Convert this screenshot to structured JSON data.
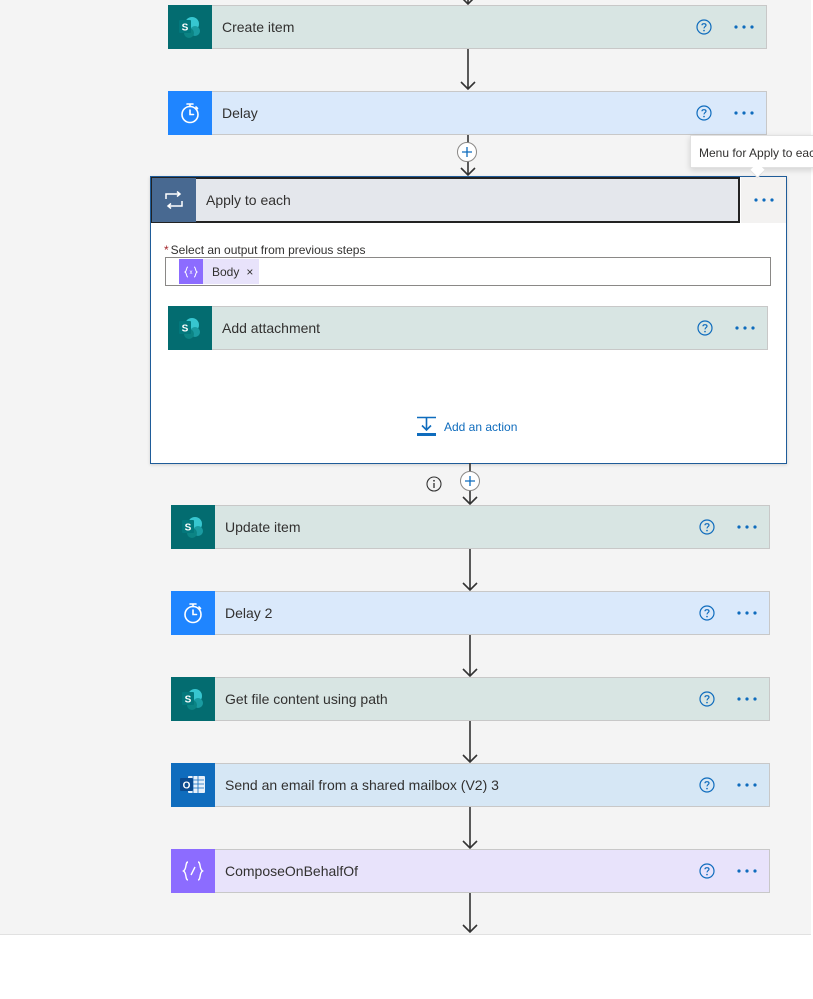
{
  "flow": {
    "create_item": {
      "title": "Create item",
      "icon": "sharepoint-icon"
    },
    "delay": {
      "title": "Delay",
      "icon": "timer-icon"
    },
    "apply_to_each": {
      "title": "Apply to each",
      "icon": "loop-icon",
      "select_label": "Select an output from previous steps",
      "required_marker": "*",
      "token": {
        "label": "Body",
        "remove": "×",
        "icon": "expression-icon"
      },
      "add_action_label": "Add an action"
    },
    "add_attachment": {
      "title": "Add attachment",
      "icon": "sharepoint-icon"
    },
    "update_item": {
      "title": "Update item",
      "icon": "sharepoint-icon"
    },
    "delay_2": {
      "title": "Delay 2",
      "icon": "timer-icon"
    },
    "get_file_content": {
      "title": "Get file content using path",
      "icon": "sharepoint-icon"
    },
    "send_email": {
      "title": "Send an email from a shared mailbox (V2) 3",
      "icon": "outlook-icon"
    },
    "compose": {
      "title": "ComposeOnBehalfOf",
      "icon": "data-operation-icon"
    }
  },
  "tooltip": "Menu for Apply to each",
  "colors": {
    "sharepoint": "#036c70",
    "timer": "#1f85ff",
    "outlook": "#0f6cbd",
    "compose": "#8c6cff",
    "loop": "#486991",
    "link": "#0f6cbd"
  }
}
